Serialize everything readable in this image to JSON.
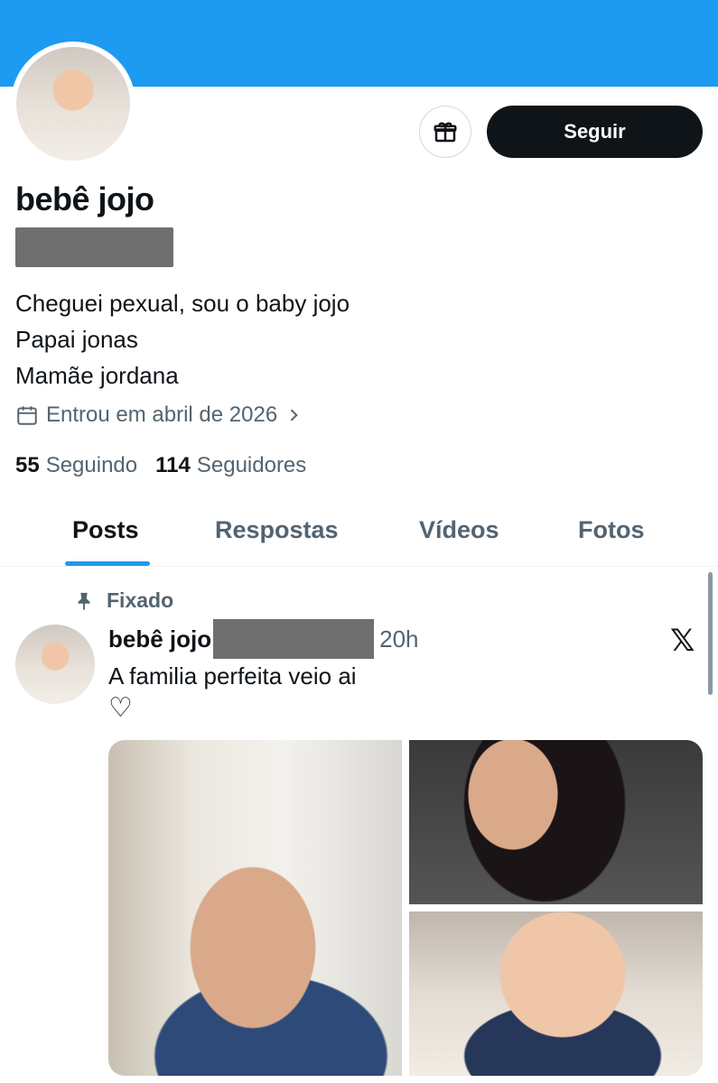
{
  "profile": {
    "display_name": "bebê jojo",
    "bio": [
      "Cheguei pexual, sou o baby jojo",
      "Papai jonas",
      "Mamãe jordana"
    ],
    "joined": "Entrou em abril de 2026",
    "following_count": "55",
    "following_label": "Seguindo",
    "followers_count": "114",
    "followers_label": "Seguidores"
  },
  "actions": {
    "follow_label": "Seguir",
    "gift_icon": "gift-icon"
  },
  "tabs": [
    {
      "label": "Posts",
      "active": true
    },
    {
      "label": "Respostas",
      "active": false
    },
    {
      "label": "Vídeos",
      "active": false
    },
    {
      "label": "Fotos",
      "active": false
    }
  ],
  "post": {
    "pinned_label": "Fixado",
    "author": "bebê jojo",
    "time": "20h",
    "text": "A familia perfeita veio ai",
    "heart": "♡",
    "source_icon": "x-logo-icon"
  },
  "colors": {
    "banner": "#1d9bf0",
    "accent": "#1d9bf0",
    "text_primary": "#0f1419",
    "text_secondary": "#536471"
  }
}
